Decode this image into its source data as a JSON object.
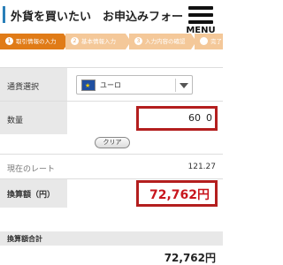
{
  "header": {
    "title": "外貨を買いたい　お申込みフォーム",
    "menu_label": "MENU"
  },
  "steps": [
    {
      "num": "1",
      "label": "取引情報の入力"
    },
    {
      "num": "2",
      "label": "基本情報入力"
    },
    {
      "num": "3",
      "label": "入力内容の確認"
    },
    {
      "num": "4",
      "label": "完了"
    }
  ],
  "form": {
    "currency_label": "通貨選択",
    "currency_value": "ユーロ",
    "quantity_label": "数量",
    "quantity_value": "60",
    "quantity_suffix": "0",
    "clear_label": "クリア",
    "rate_label": "現在のレート",
    "rate_value": "121.27",
    "amount_label": "換算額（円）",
    "amount_value": "72,762円"
  },
  "total": {
    "label": "換算額合計",
    "value": "72,762円"
  },
  "colors": {
    "accent_orange": "#e07b17",
    "inactive_step": "#f4c899",
    "highlight_red": "#b31e1e",
    "amount_red": "#c8161d",
    "header_bar_blue": "#2a7fb8"
  },
  "icons": {
    "menu": "hamburger-icon",
    "flag": "eu-flag-icon",
    "caret": "chevron-down-icon"
  }
}
